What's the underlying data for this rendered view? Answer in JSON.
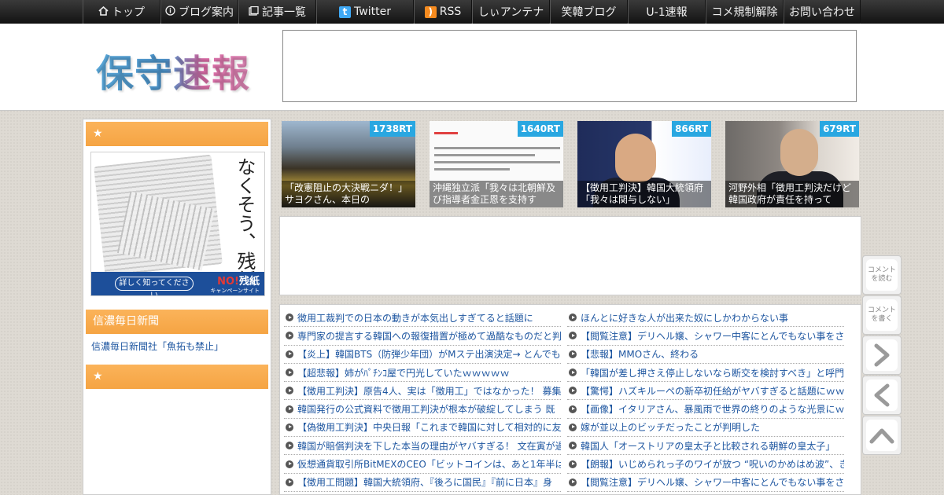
{
  "nav": {
    "items": [
      {
        "label": "トップ",
        "icon": "home-icon"
      },
      {
        "label": "ブログ案内",
        "icon": "info-icon"
      },
      {
        "label": "記事一覧",
        "icon": "list-icon"
      },
      {
        "label": "Twitter",
        "icon": "twitter-icon"
      },
      {
        "label": "RSS",
        "icon": "rss-icon"
      },
      {
        "label": "しぃアンテナ"
      },
      {
        "label": "笑韓ブログ"
      },
      {
        "label": "U-1速報"
      },
      {
        "label": "コメ規制解除"
      },
      {
        "label": "お問い合わせ"
      }
    ]
  },
  "header": {
    "logo": "保守速報"
  },
  "sidebar": {
    "widget1_title": "★",
    "banner": {
      "vertical_text": "なくそう、残紙",
      "more_button": "詳しく知ってください",
      "no_label": "NO!",
      "no_word": "残紙",
      "campaign": "キャンペーンサイト"
    },
    "widget2_title": "信濃毎日新聞",
    "widget2_link": "信濃毎日新聞社「魚拓も禁止」",
    "widget3_title": "★"
  },
  "thumbnails": [
    {
      "rt": "1738RT",
      "caption": "「改憲阻止の大決戦ニダ！」 サヨクさん、本日の"
    },
    {
      "rt": "1640RT",
      "caption": "沖縄独立派「我々は北朝鮮及び指導者金正恩を支持す"
    },
    {
      "rt": "866RT",
      "caption": "【徴用工判決】韓国大統領府「我々は関与しない」"
    },
    {
      "rt": "679RT",
      "caption": "河野外相「徴用工判決だけど韓国政府が責任を持って"
    }
  ],
  "articles_left": [
    "徴用工裁判での日本の動きが本気出しすぎてると話題に",
    "専門家の提言する韓国への報復措置が極めて過酷なものだと判",
    "【炎上】韓国BTS（防弾少年団）がMステ出演決定→ とんでも",
    "【超悲報】姉がﾊﾟﾁﾝｺ屋で円光していたｗｗｗｗｗ",
    "【徴用工判決】原告4人、実は「徴用工」ではなかった！ 募集",
    "韓国発行の公式資料で徴用工判決が根本が破綻してしまう 既",
    "【偽徴用工判決】中央日報「これまで韓国に対して相対的に友",
    "韓国が賠償判決を下した本当の理由がヤバすぎる！ 文在寅が過",
    "仮想通貨取引所BitMEXのCEO「ビットコインは、あと1年半は",
    "【徴用工問題】韓国大統領府、『後ろに国民』『前に日本』身"
  ],
  "articles_right": [
    "ほんとに好きな人が出来た奴にしかわからない事",
    "【閲覧注意】デリヘル嬢、シャワー中客にとんでもない事をさ",
    "【悲報】MMOさん、終わる",
    "「韓国が差し押さえ停止しないなら断交を検討すべき」と呼門",
    "【驚愕】ハズキルーペの新卒初任給がヤバすぎると話題にｗｗ",
    "【画像】イタリアさん、暴風雨で世界の終りのような光景にｗ",
    "嫁が並以上のビッチだったことが判明した",
    "韓国人「オーストリアの皇太子と比較される朝鮮の皇太子」",
    "【朗報】いじめられっ子のワイが放つ “呪いのかめはめ波”、き",
    "【閲覧注意】デリヘル嬢、シャワー中客にとんでもない事をさ"
  ],
  "float_buttons": {
    "read_comments": "コメントを読む",
    "write_comment": "コメントを書く"
  },
  "colors": {
    "accent_orange": "#f5a443",
    "rt_badge": "#29a7e1",
    "link_blue": "#1e56a0"
  }
}
